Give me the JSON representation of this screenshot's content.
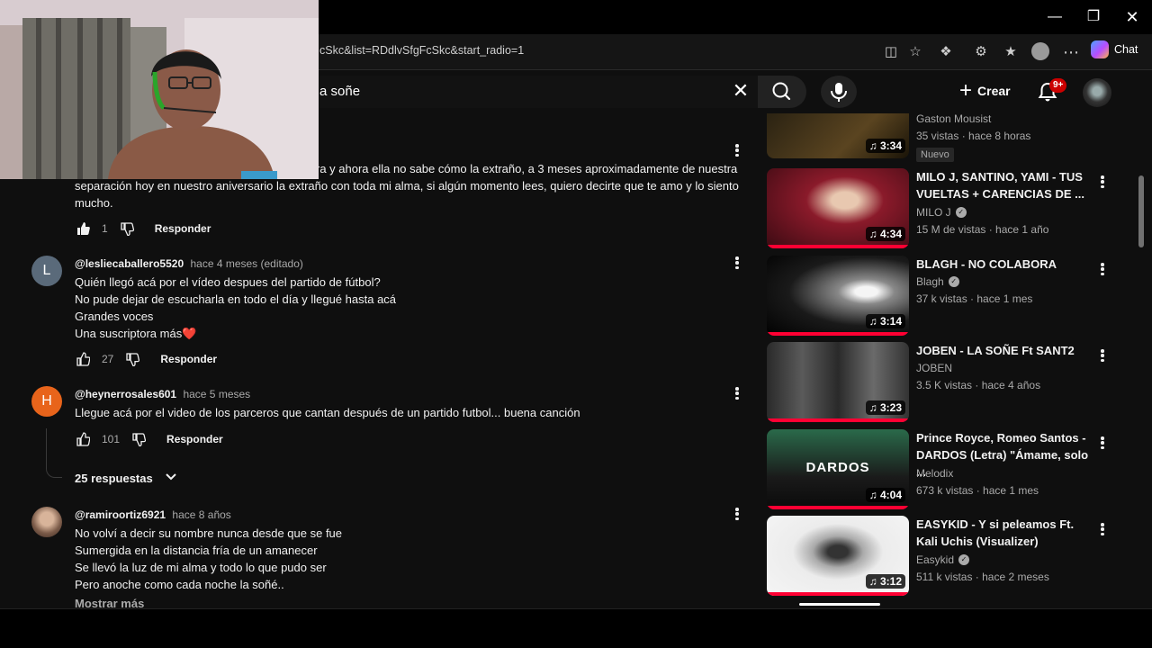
{
  "browser": {
    "url": "cSkc&list=RDdlvSfgFcSkc&start_radio=1",
    "chat_label": "Chat"
  },
  "youtube": {
    "search_value": "a soñe",
    "create_label": "Crear",
    "notifications_badge": "9+"
  },
  "comments": [
    {
      "body_lines": [
        "ra y ahora ella no sabe cómo la extraño, a 3 meses aproximadamente de nuestra",
        "separación hoy en nuestro aniversario la extraño con toda mi alma, si algún momento lees, quiero decirte que te amo y lo siento",
        "mucho."
      ],
      "likes": "1",
      "reply_label": "Responder"
    },
    {
      "avatar_letter": "L",
      "user": "@lesliecaballero5520",
      "time": "hace 4 meses (editado)",
      "body_lines": [
        "Quién llegó acá por el vídeo despues del partido de fútbol?",
        "No pude dejar de escucharla en todo el día y llegué hasta acá",
        "Grandes voces",
        "Una suscriptora más❤️"
      ],
      "likes": "27",
      "reply_label": "Responder"
    },
    {
      "avatar_letter": "H",
      "user": "@heynerrosales601",
      "time": "hace 5 meses",
      "body_lines": [
        "Llegue acá por el video de los parceros que cantan después de un partido futbol... buena canción"
      ],
      "likes": "101",
      "reply_label": "Responder",
      "replies_label": "25 respuestas"
    },
    {
      "user": "@ramiroortiz6921",
      "time": "hace 8 años",
      "body_lines": [
        "No volví a decir su nombre nunca desde que se fue",
        "Sumergida en la distancia fría de un amanecer",
        "Se llevó la luz de mi alma y todo lo que pudo ser",
        "Pero anoche como cada noche la soñé.."
      ],
      "more_label": "Mostrar más"
    }
  ],
  "sidebar": [
    {
      "duration": "3:34",
      "channel": "Gaston Mousist",
      "meta": "35 vistas · hace 8 horas",
      "badge": "Nuevo",
      "thumb_color": "#3a2e1a"
    },
    {
      "title": "MILO J, SANTINO, YAMI - TUS VUELTAS + CARENCIAS DE ...",
      "duration": "4:34",
      "channel": "MILO J",
      "verified": true,
      "meta": "15 M de vistas · hace 1 año",
      "thumb_color": "#7a1020"
    },
    {
      "title": "BLAGH - NO COLABORA",
      "duration": "3:14",
      "channel": "Blagh",
      "verified": true,
      "meta": "37 k vistas · hace 1 mes",
      "thumb_color": "#1a1a1a"
    },
    {
      "title": "JOBEN - LA SOÑE Ft SANT2",
      "duration": "3:23",
      "channel": "JOBEN",
      "verified": false,
      "meta": "3.5 K vistas · hace 4 años",
      "thumb_color": "#3b3b3b"
    },
    {
      "title": "Prince Royce, Romeo Santos - DARDOS (Letra) \"Ámame, solo ...",
      "duration": "4:04",
      "channel": "Melodix",
      "verified": false,
      "meta": "673 k vistas · hace 1 mes",
      "thumb_color": "#1d5a3a",
      "thumb_text": "DARDOS"
    },
    {
      "title": "EASYKID - Y si peleamos Ft. Kali Uchis (Visualizer)",
      "duration": "3:12",
      "channel": "Easykid",
      "verified": true,
      "meta": "511 k vistas · hace 2 meses",
      "thumb_color": "#e8e8e8"
    }
  ],
  "colors": {
    "background": "#0f0f0f",
    "accent_red": "#ff0033",
    "text_secondary": "#aaaaaa"
  }
}
